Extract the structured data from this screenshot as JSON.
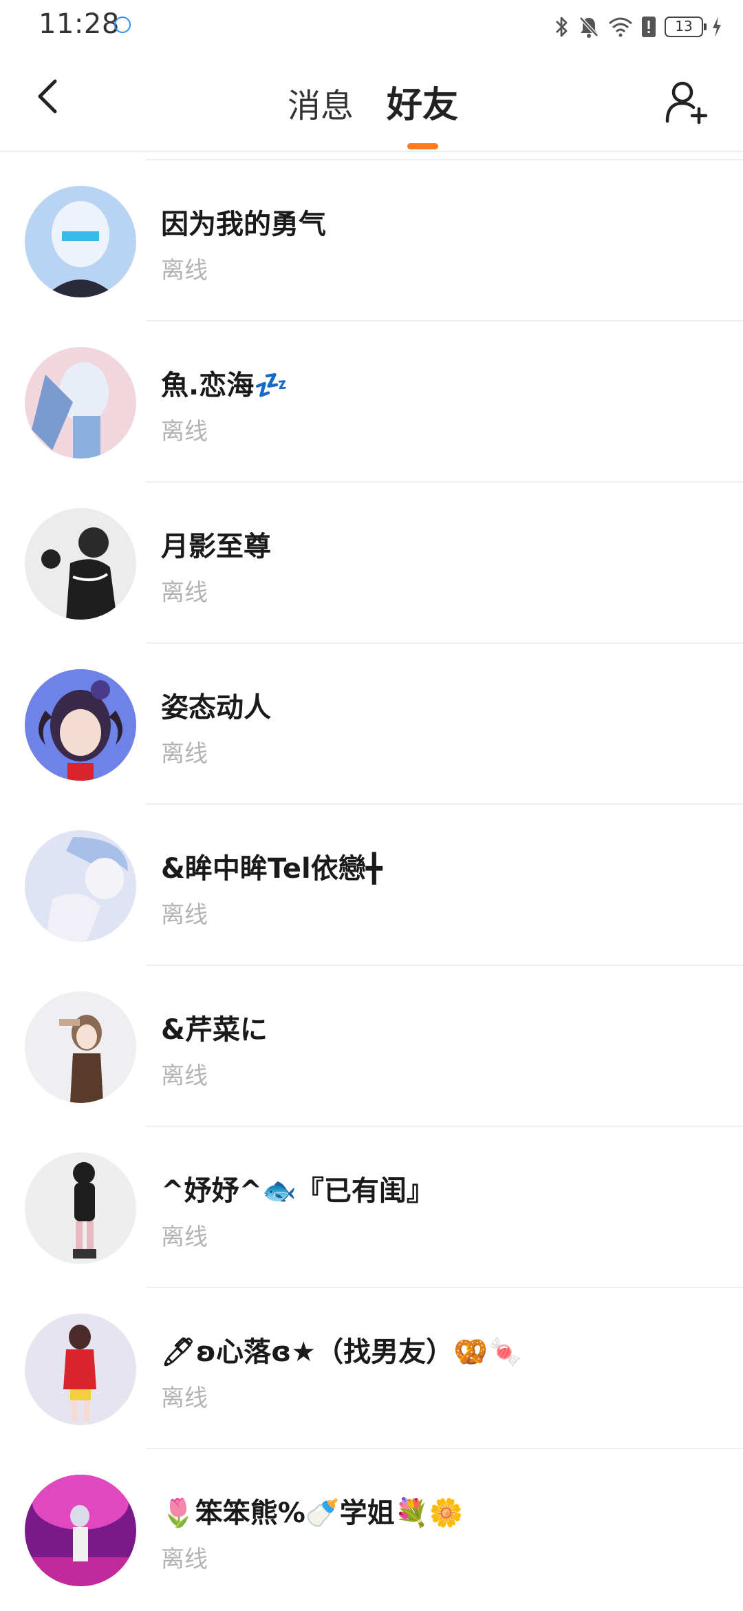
{
  "status_bar": {
    "time": "11:28",
    "badge": "iFLY",
    "battery": "13"
  },
  "header": {
    "tabs": [
      {
        "label": "消息",
        "active": false
      },
      {
        "label": "好友",
        "active": true
      }
    ],
    "accent_color": "#ff7a1a"
  },
  "friends": [
    {
      "name": "因为我的勇气",
      "status": "离线",
      "avatar_colors": [
        "#b9d3f2",
        "#eef2fb"
      ]
    },
    {
      "name": "魚.恋海💤",
      "status": "离线",
      "avatar_colors": [
        "#f2d6de",
        "#e8eef8"
      ]
    },
    {
      "name": "月影至尊",
      "status": "离线",
      "avatar_colors": [
        "#ececec",
        "#2a2a2a"
      ]
    },
    {
      "name": "姿态动人",
      "status": "离线",
      "avatar_colors": [
        "#6f82e8",
        "#3a2a4a"
      ]
    },
    {
      "name": "&眸中眸Tel依戀╋",
      "status": "离线",
      "avatar_colors": [
        "#dfe4f4",
        "#a8c0e8"
      ]
    },
    {
      "name": "&芹菜に",
      "status": "离线",
      "avatar_colors": [
        "#efeff1",
        "#8a6a52"
      ]
    },
    {
      "name": "^妤妤^🐟『已有闺』",
      "status": "离线",
      "avatar_colors": [
        "#eeeeee",
        "#1e1e1e"
      ]
    },
    {
      "name": "🖊ʚ心落ɞ★（找男友）🥨🍬",
      "status": "离线",
      "avatar_colors": [
        "#e6e4ee",
        "#d8242a"
      ]
    },
    {
      "name": "🌷笨笨熊%🍼学姐💐🌼",
      "status": "离线",
      "avatar_colors": [
        "#7a1a8a",
        "#e048c0"
      ]
    }
  ]
}
